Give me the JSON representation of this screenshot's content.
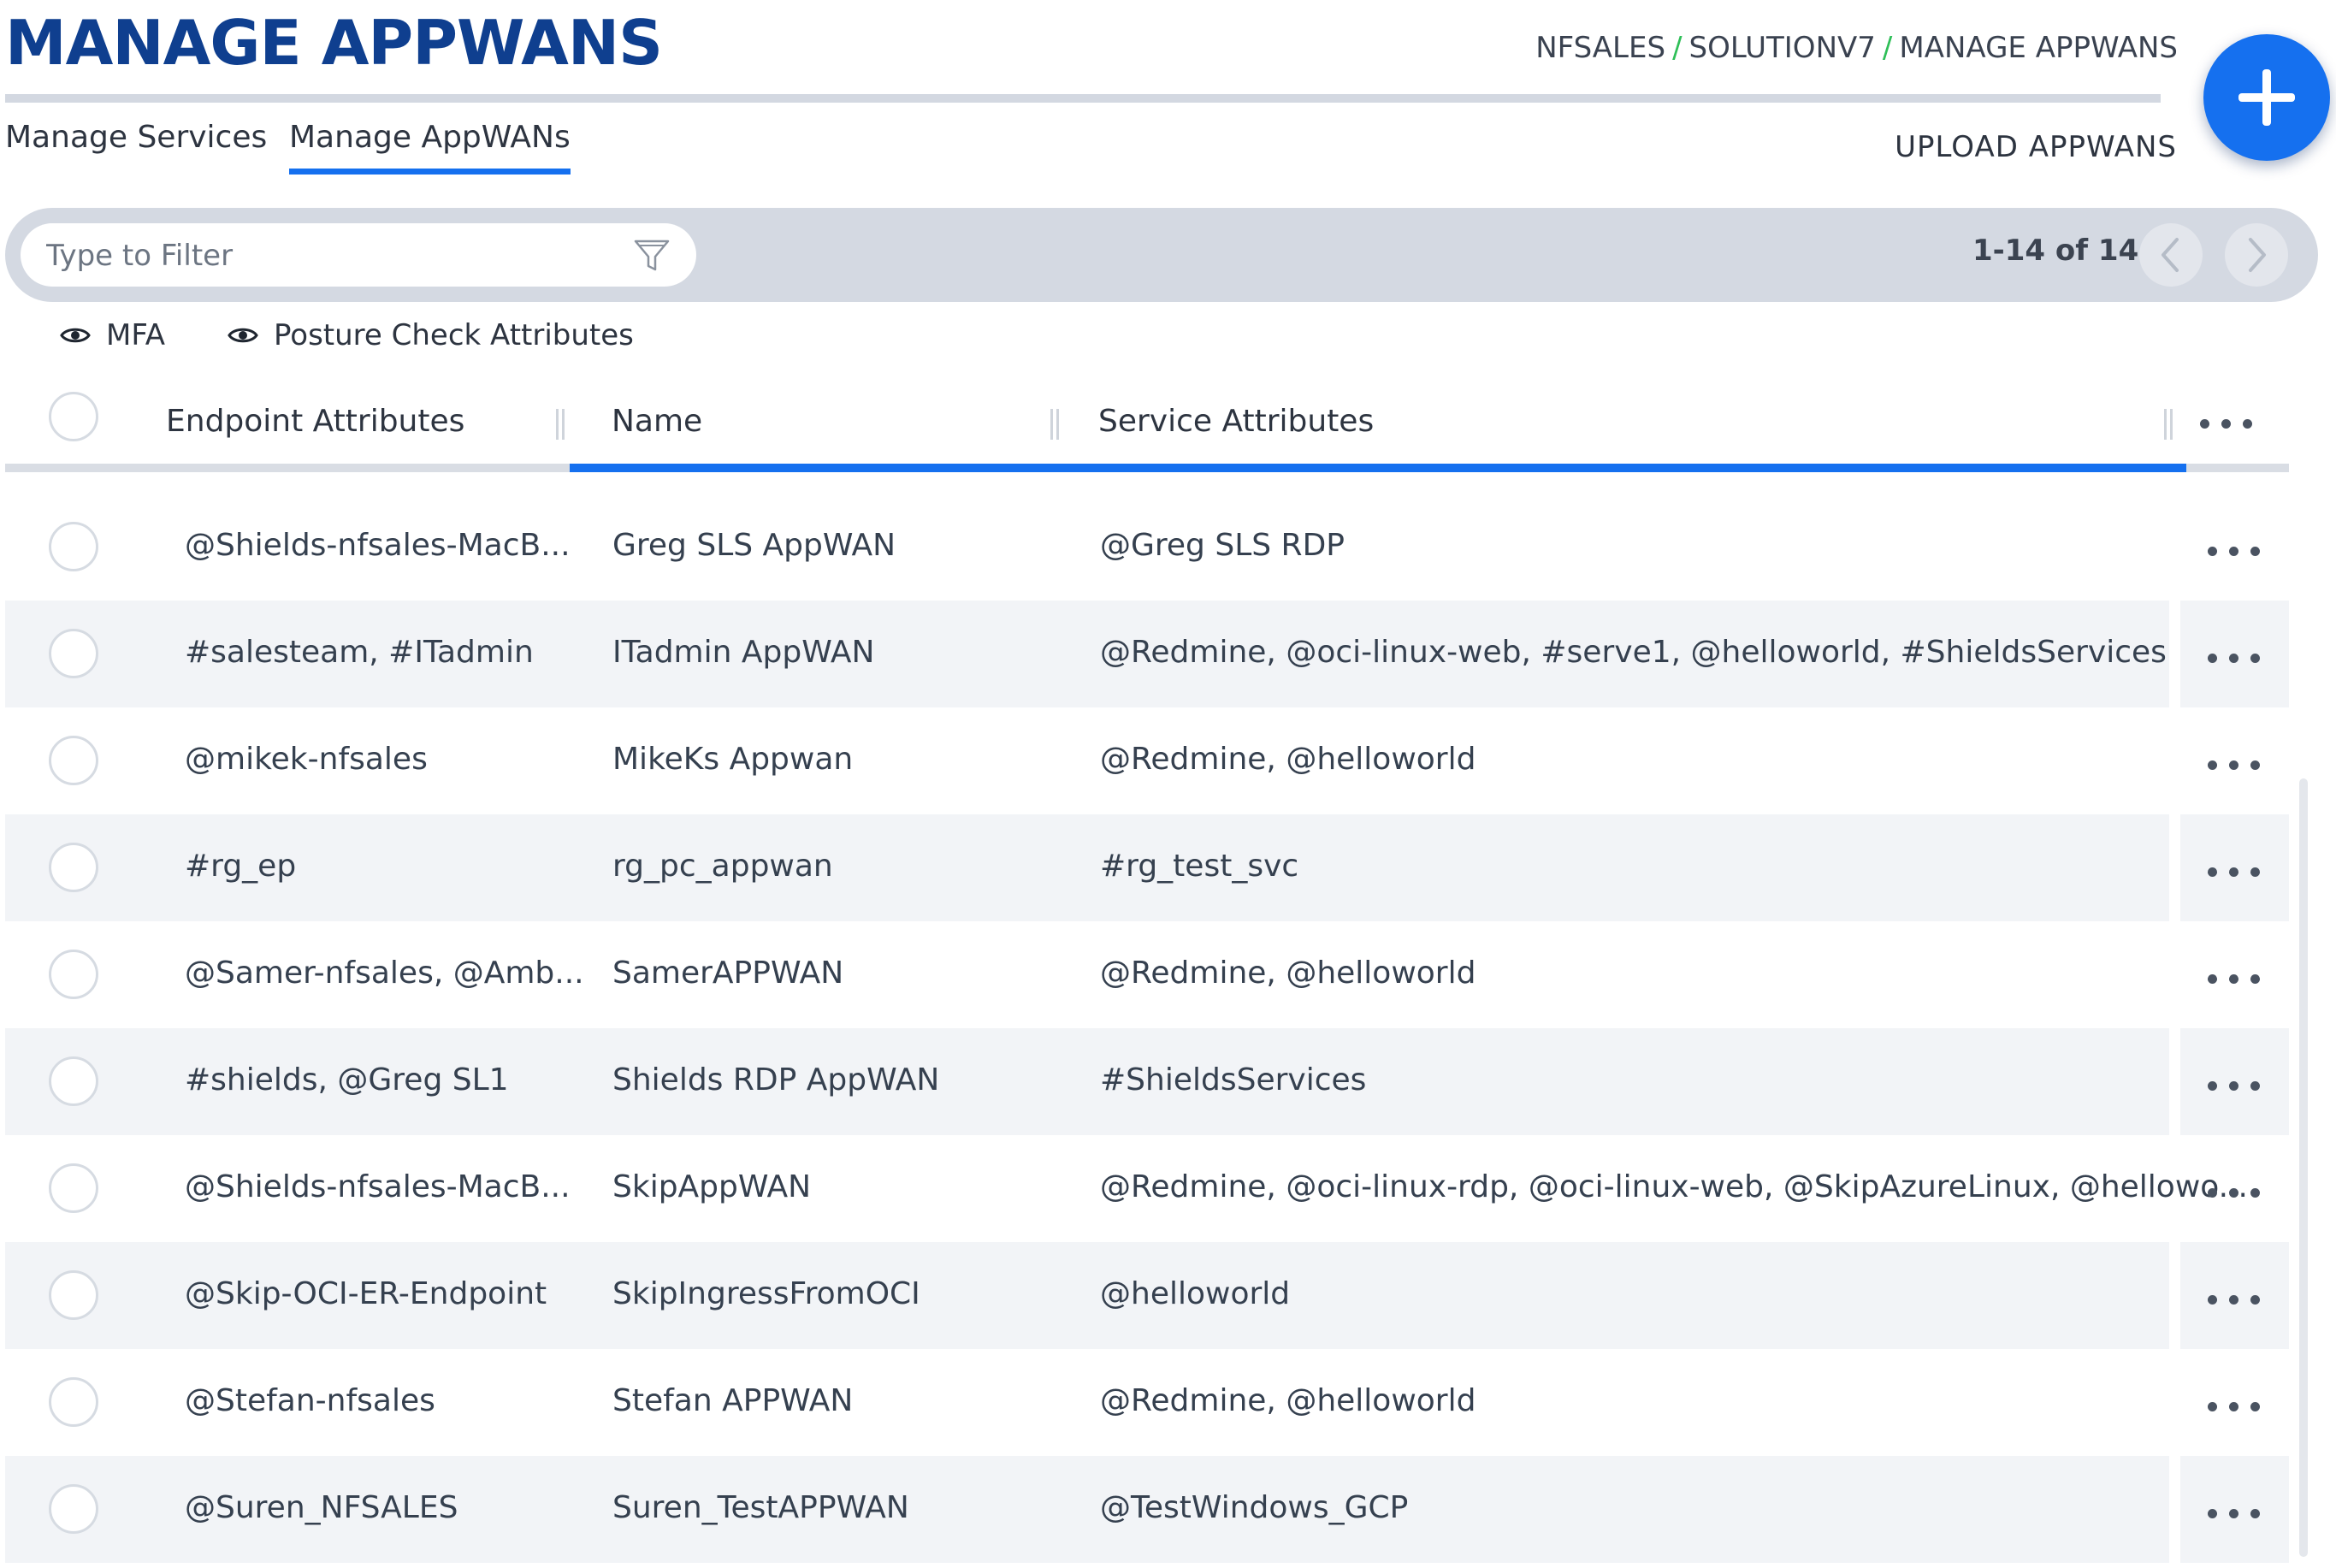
{
  "header": {
    "title": "MANAGE APPWANS",
    "breadcrumb": [
      "NFSALES",
      "SOLUTIONV7",
      "MANAGE APPWANS"
    ],
    "breadcrumb_separator": "/"
  },
  "tabs": [
    {
      "label": "Manage Services",
      "active": false
    },
    {
      "label": "Manage AppWANs",
      "active": true
    }
  ],
  "upload_label": "UPLOAD APPWANS",
  "filter": {
    "placeholder": "Type to Filter",
    "value": ""
  },
  "pager": {
    "text": "1-14 of 14"
  },
  "toggles": [
    {
      "label": "MFA",
      "icon": "eye-icon"
    },
    {
      "label": "Posture Check Attributes",
      "icon": "eye-icon"
    }
  ],
  "columns": {
    "endpoint": "Endpoint Attributes",
    "name": "Name",
    "service": "Service Attributes"
  },
  "rows": [
    {
      "endpoint": "@Shields-nfsales-MacB...",
      "name": "Greg SLS AppWAN",
      "service": "@Greg SLS RDP"
    },
    {
      "endpoint": "#salesteam, #ITadmin",
      "name": "ITadmin AppWAN",
      "service": "@Redmine, @oci-linux-web, #serve1, @helloworld, #ShieldsServices"
    },
    {
      "endpoint": "@mikek-nfsales",
      "name": "MikeKs Appwan",
      "service": "@Redmine, @helloworld"
    },
    {
      "endpoint": "#rg_ep",
      "name": "rg_pc_appwan",
      "service": "#rg_test_svc"
    },
    {
      "endpoint": "@Samer-nfsales, @Amb...",
      "name": "SamerAPPWAN",
      "service": "@Redmine, @helloworld"
    },
    {
      "endpoint": "#shields, @Greg SL1",
      "name": "Shields RDP AppWAN",
      "service": "#ShieldsServices"
    },
    {
      "endpoint": "@Shields-nfsales-MacB...",
      "name": "SkipAppWAN",
      "service": "@Redmine, @oci-linux-rdp, @oci-linux-web, @SkipAzureLinux, @hellowo..."
    },
    {
      "endpoint": "@Skip-OCI-ER-Endpoint",
      "name": "SkipIngressFromOCI",
      "service": "@helloworld"
    },
    {
      "endpoint": "@Stefan-nfsales",
      "name": "Stefan APPWAN",
      "service": "@Redmine, @helloworld"
    },
    {
      "endpoint": "@Suren_NFSALES",
      "name": "Suren_TestAPPWAN",
      "service": "@TestWindows_GCP"
    }
  ],
  "colors": {
    "title": "#0f3f8f",
    "accent": "#1570ef",
    "breadcrumb_separator": "#2fbf58",
    "toolbar_bg": "#d4d9e2",
    "row_alt_bg": "#f2f4f7"
  }
}
